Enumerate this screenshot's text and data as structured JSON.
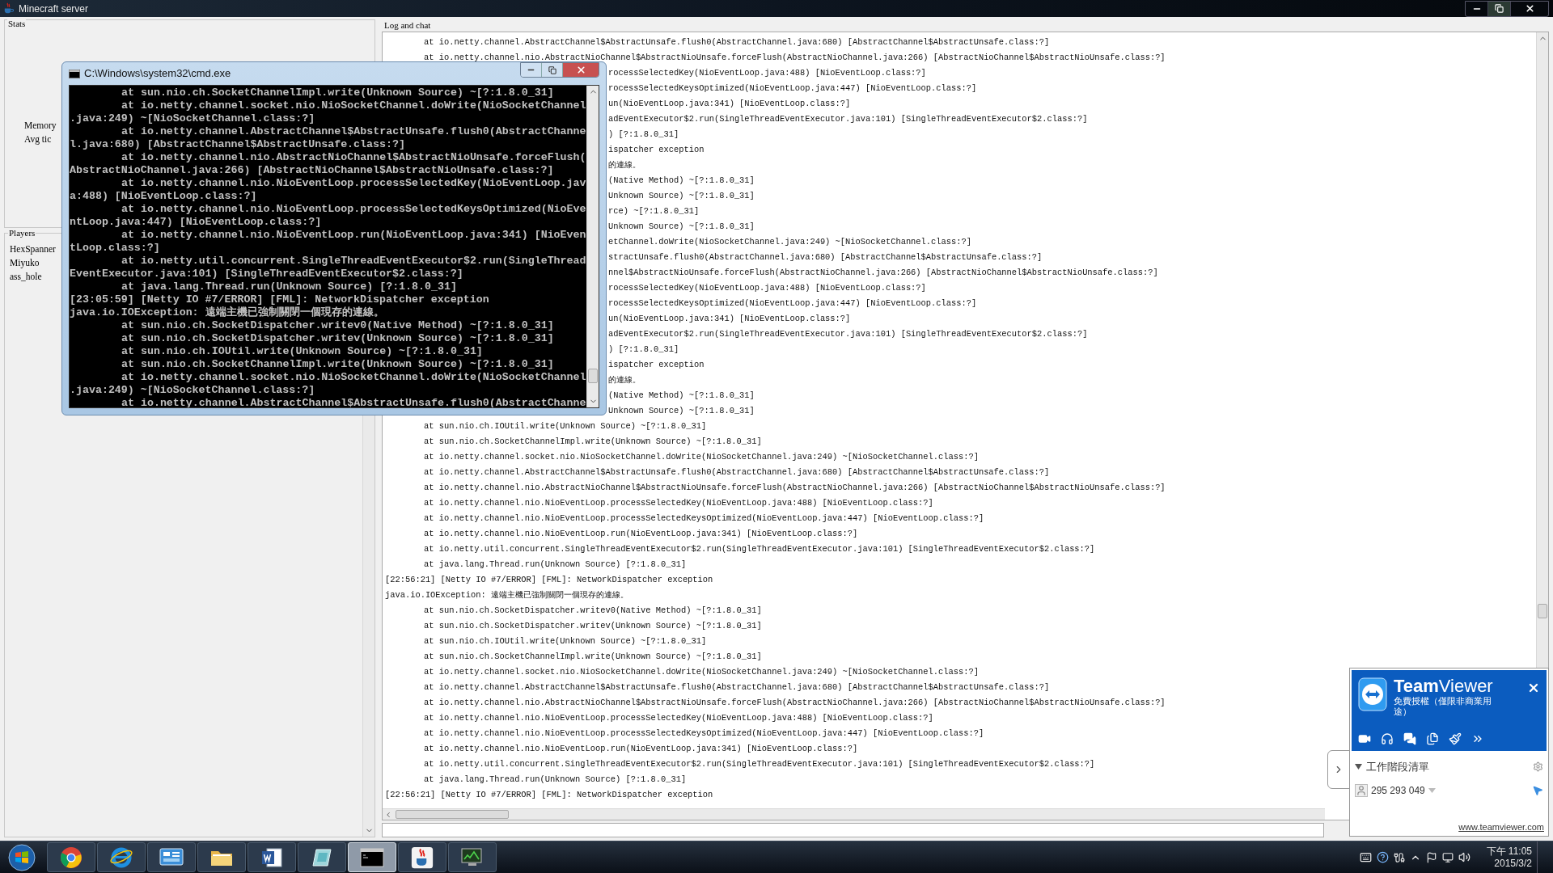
{
  "window": {
    "title": "Minecraft server"
  },
  "stats": {
    "title": "Stats",
    "labels": [
      "Memory",
      "Avg tic"
    ]
  },
  "players": {
    "title": "Players",
    "items": [
      "HexSpanner",
      "Miyuko",
      "ass_hole"
    ]
  },
  "log": {
    "title": "Log and chat",
    "lines": [
      {
        "kind": "frame",
        "text": "at io.netty.channel.AbstractChannel$AbstractUnsafe.flush0(AbstractChannel.java:680) [AbstractChannel$AbstractUnsafe.class:?]"
      },
      {
        "kind": "frame",
        "text": "at io.netty.channel.nio.AbstractNioChannel$AbstractNioUnsafe.forceFlush(AbstractNioChannel.java:266) [AbstractNioChannel$AbstractNioUnsafe.class:?]"
      },
      {
        "kind": "covered",
        "text": "rocessSelectedKey(NioEventLoop.java:488) [NioEventLoop.class:?]"
      },
      {
        "kind": "covered",
        "text": "rocessSelectedKeysOptimized(NioEventLoop.java:447) [NioEventLoop.class:?]"
      },
      {
        "kind": "covered",
        "text": "un(NioEventLoop.java:341) [NioEventLoop.class:?]"
      },
      {
        "kind": "covered",
        "text": "adEventExecutor$2.run(SingleThreadEventExecutor.java:101) [SingleThreadEventExecutor$2.class:?]"
      },
      {
        "kind": "covered",
        "text": ") [?:1.8.0_31]"
      },
      {
        "kind": "covered",
        "text": "ispatcher exception"
      },
      {
        "kind": "covered",
        "text": "的連線。"
      },
      {
        "kind": "covered",
        "text": "(Native Method) ~[?:1.8.0_31]"
      },
      {
        "kind": "covered",
        "text": "Unknown Source) ~[?:1.8.0_31]"
      },
      {
        "kind": "covered",
        "text": "rce) ~[?:1.8.0_31]"
      },
      {
        "kind": "covered",
        "text": "Unknown Source) ~[?:1.8.0_31]"
      },
      {
        "kind": "covered",
        "text": "etChannel.doWrite(NioSocketChannel.java:249) ~[NioSocketChannel.class:?]"
      },
      {
        "kind": "covered",
        "text": "stractUnsafe.flush0(AbstractChannel.java:680) [AbstractChannel$AbstractUnsafe.class:?]"
      },
      {
        "kind": "covered",
        "text": "nnel$AbstractNioUnsafe.forceFlush(AbstractNioChannel.java:266) [AbstractNioChannel$AbstractNioUnsafe.class:?]"
      },
      {
        "kind": "covered",
        "text": "rocessSelectedKey(NioEventLoop.java:488) [NioEventLoop.class:?]"
      },
      {
        "kind": "covered",
        "text": "rocessSelectedKeysOptimized(NioEventLoop.java:447) [NioEventLoop.class:?]"
      },
      {
        "kind": "covered",
        "text": "un(NioEventLoop.java:341) [NioEventLoop.class:?]"
      },
      {
        "kind": "covered",
        "text": "adEventExecutor$2.run(SingleThreadEventExecutor.java:101) [SingleThreadEventExecutor$2.class:?]"
      },
      {
        "kind": "covered",
        "text": ") [?:1.8.0_31]"
      },
      {
        "kind": "covered",
        "text": "ispatcher exception"
      },
      {
        "kind": "covered",
        "text": "的連線。"
      },
      {
        "kind": "covered",
        "text": "(Native Method) ~[?:1.8.0_31]"
      },
      {
        "kind": "covered",
        "text": "Unknown Source) ~[?:1.8.0_31]"
      },
      {
        "kind": "frame",
        "text": "at sun.nio.ch.IOUtil.write(Unknown Source) ~[?:1.8.0_31]"
      },
      {
        "kind": "frame",
        "text": "at sun.nio.ch.SocketChannelImpl.write(Unknown Source) ~[?:1.8.0_31]"
      },
      {
        "kind": "frame",
        "text": "at io.netty.channel.socket.nio.NioSocketChannel.doWrite(NioSocketChannel.java:249) ~[NioSocketChannel.class:?]"
      },
      {
        "kind": "frame",
        "text": "at io.netty.channel.AbstractChannel$AbstractUnsafe.flush0(AbstractChannel.java:680) [AbstractChannel$AbstractUnsafe.class:?]"
      },
      {
        "kind": "frame",
        "text": "at io.netty.channel.nio.AbstractNioChannel$AbstractNioUnsafe.forceFlush(AbstractNioChannel.java:266) [AbstractNioChannel$AbstractNioUnsafe.class:?]"
      },
      {
        "kind": "frame",
        "text": "at io.netty.channel.nio.NioEventLoop.processSelectedKey(NioEventLoop.java:488) [NioEventLoop.class:?]"
      },
      {
        "kind": "frame",
        "text": "at io.netty.channel.nio.NioEventLoop.processSelectedKeysOptimized(NioEventLoop.java:447) [NioEventLoop.class:?]"
      },
      {
        "kind": "frame",
        "text": "at io.netty.channel.nio.NioEventLoop.run(NioEventLoop.java:341) [NioEventLoop.class:?]"
      },
      {
        "kind": "frame",
        "text": "at io.netty.util.concurrent.SingleThreadEventExecutor$2.run(SingleThreadEventExecutor.java:101) [SingleThreadEventExecutor$2.class:?]"
      },
      {
        "kind": "frame",
        "text": "at java.lang.Thread.run(Unknown Source) [?:1.8.0_31]"
      },
      {
        "kind": "header",
        "text": "[22:56:21] [Netty IO #7/ERROR] [FML]: NetworkDispatcher exception"
      },
      {
        "kind": "header",
        "text": "java.io.IOException: 遠端主機已強制關閉一個現存的連線。"
      },
      {
        "kind": "frame",
        "text": "at sun.nio.ch.SocketDispatcher.writev0(Native Method) ~[?:1.8.0_31]"
      },
      {
        "kind": "frame",
        "text": "at sun.nio.ch.SocketDispatcher.writev(Unknown Source) ~[?:1.8.0_31]"
      },
      {
        "kind": "frame",
        "text": "at sun.nio.ch.IOUtil.write(Unknown Source) ~[?:1.8.0_31]"
      },
      {
        "kind": "frame",
        "text": "at sun.nio.ch.SocketChannelImpl.write(Unknown Source) ~[?:1.8.0_31]"
      },
      {
        "kind": "frame",
        "text": "at io.netty.channel.socket.nio.NioSocketChannel.doWrite(NioSocketChannel.java:249) ~[NioSocketChannel.class:?]"
      },
      {
        "kind": "frame",
        "text": "at io.netty.channel.AbstractChannel$AbstractUnsafe.flush0(AbstractChannel.java:680) [AbstractChannel$AbstractUnsafe.class:?]"
      },
      {
        "kind": "frame",
        "text": "at io.netty.channel.nio.AbstractNioChannel$AbstractNioUnsafe.forceFlush(AbstractNioChannel.java:266) [AbstractNioChannel$AbstractNioUnsafe.class:?]"
      },
      {
        "kind": "frame",
        "text": "at io.netty.channel.nio.NioEventLoop.processSelectedKey(NioEventLoop.java:488) [NioEventLoop.class:?]"
      },
      {
        "kind": "frame",
        "text": "at io.netty.channel.nio.NioEventLoop.processSelectedKeysOptimized(NioEventLoop.java:447) [NioEventLoop.class:?]"
      },
      {
        "kind": "frame",
        "text": "at io.netty.channel.nio.NioEventLoop.run(NioEventLoop.java:341) [NioEventLoop.class:?]"
      },
      {
        "kind": "frame",
        "text": "at io.netty.util.concurrent.SingleThreadEventExecutor$2.run(SingleThreadEventExecutor.java:101) [SingleThreadEventExecutor$2.class:?]"
      },
      {
        "kind": "frame",
        "text": "at java.lang.Thread.run(Unknown Source) [?:1.8.0_31]"
      },
      {
        "kind": "header",
        "text": "[22:56:21] [Netty IO #7/ERROR] [FML]: NetworkDispatcher exception"
      }
    ]
  },
  "console_window": {
    "title": "C:\\Windows\\system32\\cmd.exe",
    "rows": [
      {
        "kind": "frame",
        "text": "at sun.nio.ch.SocketChannelImpl.write(Unknown Source) ~[?:1.8.0_31]"
      },
      {
        "kind": "frame",
        "text": "at io.netty.channel.socket.nio.NioSocketChannel.doWrite(NioSocketChannel"
      },
      {
        "kind": "wrap",
        "text": ".java:249) ~[NioSocketChannel.class:?]"
      },
      {
        "kind": "frame",
        "text": "at io.netty.channel.AbstractChannel$AbstractUnsafe.flush0(AbstractChanne"
      },
      {
        "kind": "wrap",
        "text": "l.java:680) [AbstractChannel$AbstractUnsafe.class:?]"
      },
      {
        "kind": "frame",
        "text": "at io.netty.channel.nio.AbstractNioChannel$AbstractNioUnsafe.forceFlush("
      },
      {
        "kind": "wrap",
        "text": "AbstractNioChannel.java:266) [AbstractNioChannel$AbstractNioUnsafe.class:?]"
      },
      {
        "kind": "frame",
        "text": "at io.netty.channel.nio.NioEventLoop.processSelectedKey(NioEventLoop.jav"
      },
      {
        "kind": "wrap",
        "text": "a:488) [NioEventLoop.class:?]"
      },
      {
        "kind": "frame",
        "text": "at io.netty.channel.nio.NioEventLoop.processSelectedKeysOptimized(NioEve"
      },
      {
        "kind": "wrap",
        "text": "ntLoop.java:447) [NioEventLoop.class:?]"
      },
      {
        "kind": "frame",
        "text": "at io.netty.channel.nio.NioEventLoop.run(NioEventLoop.java:341) [NioEven"
      },
      {
        "kind": "wrap",
        "text": "tLoop.class:?]"
      },
      {
        "kind": "frame",
        "text": "at io.netty.util.concurrent.SingleThreadEventExecutor$2.run(SingleThread"
      },
      {
        "kind": "wrap",
        "text": "EventExecutor.java:101) [SingleThreadEventExecutor$2.class:?]"
      },
      {
        "kind": "frame",
        "text": "at java.lang.Thread.run(Unknown Source) [?:1.8.0_31]"
      },
      {
        "kind": "wrap",
        "text": "[23:05:59] [Netty IO #7/ERROR] [FML]: NetworkDispatcher exception"
      },
      {
        "kind": "wrap",
        "text": "java.io.IOException: 遠端主機已強制關閉一個現存的連線。"
      },
      {
        "kind": "frame",
        "text": "at sun.nio.ch.SocketDispatcher.writev0(Native Method) ~[?:1.8.0_31]"
      },
      {
        "kind": "frame",
        "text": "at sun.nio.ch.SocketDispatcher.writev(Unknown Source) ~[?:1.8.0_31]"
      },
      {
        "kind": "frame",
        "text": "at sun.nio.ch.IOUtil.write(Unknown Source) ~[?:1.8.0_31]"
      },
      {
        "kind": "frame",
        "text": "at sun.nio.ch.SocketChannelImpl.write(Unknown Source) ~[?:1.8.0_31]"
      },
      {
        "kind": "frame",
        "text": "at io.netty.channel.socket.nio.NioSocketChannel.doWrite(NioSocketChannel"
      },
      {
        "kind": "wrap",
        "text": ".java:249) ~[NioSocketChannel.class:?]"
      },
      {
        "kind": "frame",
        "text": "at io.netty.channel.AbstractChannel$AbstractUnsafe.flush0(AbstractChanne"
      }
    ]
  },
  "teamviewer": {
    "brand": "**Team**Viewer",
    "license": "免費授權（僅限非商業用途）",
    "session_list": "工作階段清單",
    "partner_id": "295 293 049",
    "link": "www.teamviewer.com"
  },
  "taskbar": {
    "buttons": [
      {
        "selected": false
      },
      {
        "selected": false
      },
      {
        "selected": false
      },
      {
        "selected": false
      },
      {
        "selected": false
      },
      {
        "selected": false
      },
      {
        "selected": true
      },
      {
        "selected": false
      },
      {
        "selected": false
      }
    ],
    "clock": {
      "time": "下午 11:05",
      "date": "2015/3/2"
    }
  }
}
